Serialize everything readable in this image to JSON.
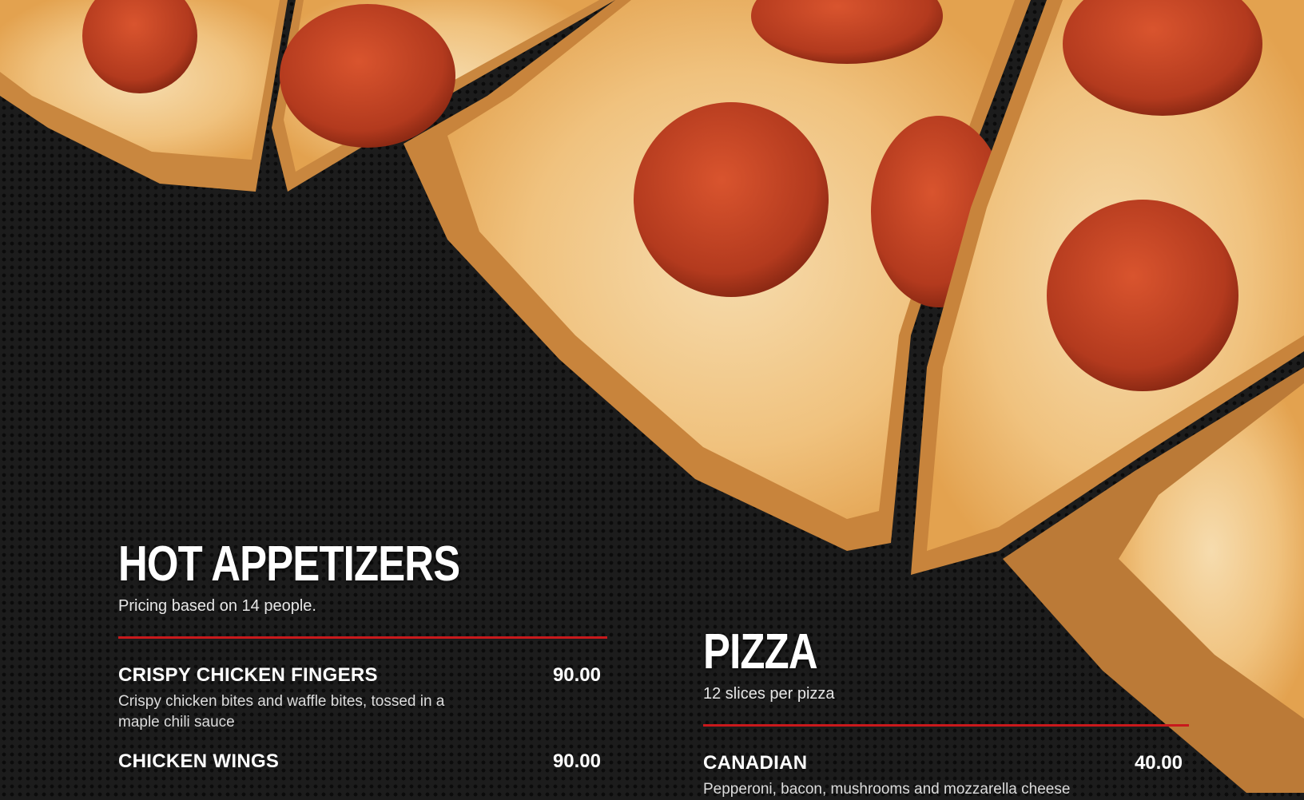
{
  "colors": {
    "background": "#1c1c1c",
    "accent_rule": "#c8191c",
    "crust": "#c98a44",
    "cheese": "#f2c98a",
    "pepperoni": "#b93a1f"
  },
  "appetizers": {
    "title": "HOT APPETIZERS",
    "subtitle": "Pricing based on 14 people.",
    "items": [
      {
        "name": "CRISPY CHICKEN FINGERS",
        "price": "90.00",
        "desc": "Crispy chicken bites and waffle bites, tossed in a maple chili sauce"
      },
      {
        "name": "CHICKEN WINGS",
        "price": "90.00",
        "desc": ""
      }
    ]
  },
  "pizza": {
    "title": "PIZZA",
    "subtitle": "12 slices per pizza",
    "items": [
      {
        "name": "CANADIAN",
        "price": "40.00",
        "desc": "Pepperoni, bacon, mushrooms and mozzarella cheese"
      }
    ]
  }
}
